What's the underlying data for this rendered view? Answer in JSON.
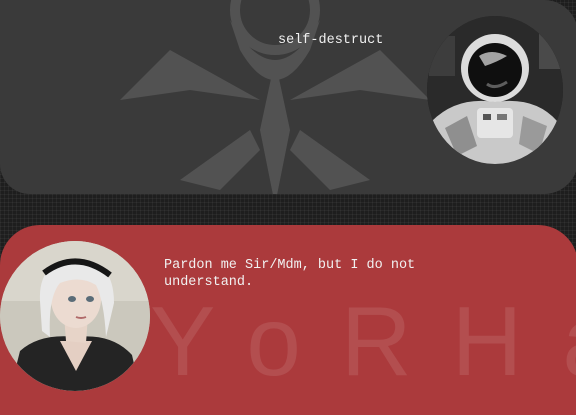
{
  "conversation": {
    "messages": [
      {
        "sender": "user",
        "text": "self-destruct",
        "avatar_icon": "astronaut-avatar"
      },
      {
        "sender": "bot",
        "text": "Pardon me Sir/Mdm, but I do not understand.",
        "avatar_icon": "android-avatar"
      }
    ]
  },
  "background": {
    "bot_watermark": "YoRHa",
    "emblem_icon": "yorha-emblem-icon"
  },
  "colors": {
    "page_background": "#1e1e1e",
    "user_bubble": "#3a3a3a",
    "bot_bubble": "#ab3a3c",
    "message_text": "#f1f1f1"
  }
}
